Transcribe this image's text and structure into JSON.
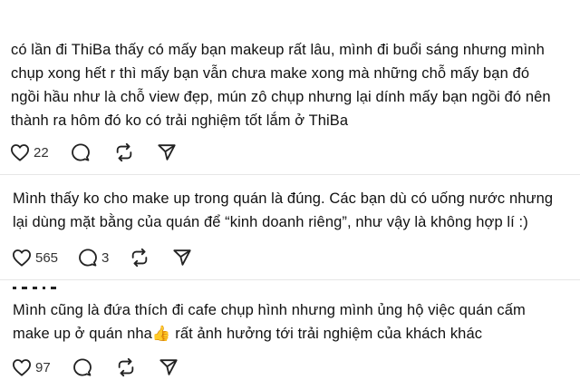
{
  "posts": [
    {
      "lines": [
        "có lần đi ThiBa thấy có mấy bạn makeup rất lâu, mình đi buổi sáng nhưng mình",
        "chụp xong hết r thì mấy bạn vẫn chưa make xong mà những chỗ mấy bạn đó",
        "ngồi hầu như là chỗ view đẹp, mún zô chụp nhưng lại dính mấy bạn ngồi đó nên",
        "thành ra hôm đó ko có trải nghiệm tốt lắm ở ThiBa"
      ],
      "likes": "22",
      "comments": ""
    },
    {
      "lines": [
        "Mình thấy ko cho make up trong quán là đúng. Các bạn dù có uống nước nhưng",
        "lại dùng mặt bằng của quán để “kinh doanh riêng”, như vậy là không hợp lí :)"
      ],
      "likes": "565",
      "comments": "3"
    },
    {
      "lines": [
        "Mình cũng là đứa thích đi cafe chụp hình nhưng mình ủng hộ việc quán cấm",
        "make up ở quán nha👍 rất ảnh hưởng tới trải nghiệm của khách khác"
      ],
      "likes": "97",
      "comments": ""
    }
  ],
  "icons": {
    "like": "heart-icon",
    "comment": "comment-bubble-icon",
    "repost": "repost-icon",
    "share": "send-icon"
  },
  "colors": {
    "text": "#111111",
    "icon": "#222222",
    "divider": "#e6e6e6"
  }
}
